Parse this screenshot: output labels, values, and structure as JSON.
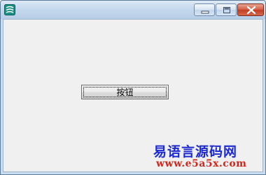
{
  "window": {
    "title": "",
    "icon": "app-icon"
  },
  "titlebar_controls": {
    "minimize": "minimize-icon",
    "maximize": "maximize-icon",
    "close": "close-icon"
  },
  "main": {
    "button_label": "按钮"
  },
  "watermark": {
    "name": "易语言源码网",
    "url": "www.e5a5x.com"
  },
  "colors": {
    "close_button": "#c43d20",
    "watermark_name": "#1d2ad1",
    "watermark_url": "#d1261b"
  }
}
